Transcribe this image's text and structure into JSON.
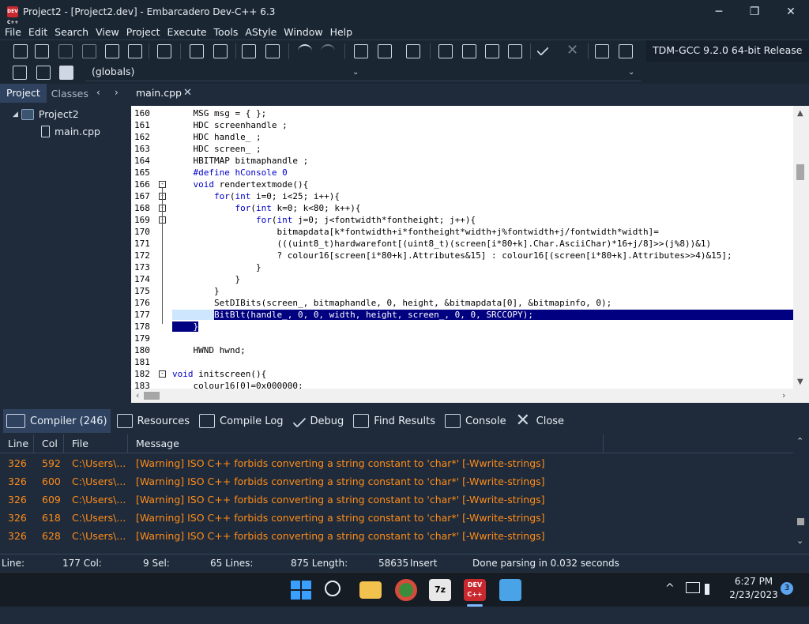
{
  "window": {
    "title": "Project2 - [Project2.dev] - Embarcadero Dev-C++ 6.3",
    "app_icon_text": "DEV C++",
    "minimize": "─",
    "maximize": "❐",
    "close": "✕"
  },
  "menu": [
    "File",
    "Edit",
    "Search",
    "View",
    "Project",
    "Execute",
    "Tools",
    "AStyle",
    "Window",
    "Help"
  ],
  "toolbar": {
    "compiler_label": "TDM-GCC 9.2.0 64-bit Release",
    "globals": "(globals)"
  },
  "left_panel": {
    "tabs": [
      "Project",
      "Classes"
    ],
    "arrow_left": "‹",
    "arrow_right": "›",
    "tree": {
      "root": "Project2",
      "child": "main.cpp"
    }
  },
  "editor": {
    "tab": "main.cpp",
    "tab_close": "✕",
    "lines": [
      {
        "n": "160",
        "t": "    MSG msg = { };"
      },
      {
        "n": "161",
        "t": "    HDC screenhandle ;"
      },
      {
        "n": "162",
        "t": "    HDC handle_ ;"
      },
      {
        "n": "163",
        "t": "    HDC screen_ ;"
      },
      {
        "n": "164",
        "t": "    HBITMAP bitmaphandle ;"
      },
      {
        "n": "165",
        "t": "    #define hConsole 0"
      },
      {
        "n": "166",
        "t": "    void rendertextmode(){"
      },
      {
        "n": "167",
        "t": "        for(int i=0; i<25; i++){"
      },
      {
        "n": "168",
        "t": "            for(int k=0; k<80; k++){"
      },
      {
        "n": "169",
        "t": "                for(int j=0; j<fontwidth*fontheight; j++){"
      },
      {
        "n": "170",
        "t": "                    bitmapdata[k*fontwidth+i*fontheight*width+j%fontwidth+j/fontwidth*width]="
      },
      {
        "n": "171",
        "t": "                    (((uint8_t)hardwarefont[(uint8_t)(screen[i*80+k].Char.AsciiChar)*16+j/8]>>(j%8))&1)"
      },
      {
        "n": "172",
        "t": "                    ? colour16[screen[i*80+k].Attributes&15] : colour16[(screen[i*80+k].Attributes>>4)&15];"
      },
      {
        "n": "173",
        "t": "                }"
      },
      {
        "n": "174",
        "t": "            }"
      },
      {
        "n": "175",
        "t": "        }"
      },
      {
        "n": "176",
        "t": "        SetDIBits(screen_, bitmaphandle, 0, height, &bitmapdata[0], &bitmapinfo, 0);"
      },
      {
        "n": "177",
        "t": "        BitBlt(handle_, 0, 0, width, height, screen_, 0, 0, SRCCOPY);"
      },
      {
        "n": "178",
        "t": "    }"
      },
      {
        "n": "179",
        "t": ""
      },
      {
        "n": "180",
        "t": "    HWND hwnd;"
      },
      {
        "n": "181",
        "t": ""
      },
      {
        "n": "182",
        "t": "void initscreen(){"
      },
      {
        "n": "183",
        "t": "    colour16[0]=0x000000;"
      }
    ]
  },
  "bottom_tabs": [
    "Compiler (246)",
    "Resources",
    "Compile Log",
    "Debug",
    "Find Results",
    "Console",
    "Close"
  ],
  "messages": {
    "headers": [
      "Line",
      "Col",
      "File",
      "Message"
    ],
    "rows": [
      {
        "line": "326",
        "col": "592",
        "file": "C:\\Users\\...",
        "msg": "[Warning] ISO C++ forbids converting a string constant to 'char*' [-Wwrite-strings]"
      },
      {
        "line": "326",
        "col": "600",
        "file": "C:\\Users\\...",
        "msg": "[Warning] ISO C++ forbids converting a string constant to 'char*' [-Wwrite-strings]"
      },
      {
        "line": "326",
        "col": "609",
        "file": "C:\\Users\\...",
        "msg": "[Warning] ISO C++ forbids converting a string constant to 'char*' [-Wwrite-strings]"
      },
      {
        "line": "326",
        "col": "618",
        "file": "C:\\Users\\...",
        "msg": "[Warning] ISO C++ forbids converting a string constant to 'char*' [-Wwrite-strings]"
      },
      {
        "line": "326",
        "col": "628",
        "file": "C:\\Users\\...",
        "msg": "[Warning] ISO C++ forbids converting a string constant to 'char*' [-Wwrite-strings]"
      }
    ]
  },
  "status": {
    "line_label": "Line:",
    "line_val": "177 Col:",
    "col_val": "9 Sel:",
    "sel_val": "65 Lines:",
    "lines_val": "875 Length:",
    "length_val": "58635",
    "mode": "Insert",
    "message": "Done parsing in 0.032 seconds"
  },
  "taskbar": {
    "time": "6:27 PM",
    "date": "2/23/2023",
    "notif_count": "3",
    "up_arrow": "^"
  },
  "colors": {
    "warning": "#ff8c1a",
    "selection": "#000080",
    "keyword": "#0000c8"
  }
}
